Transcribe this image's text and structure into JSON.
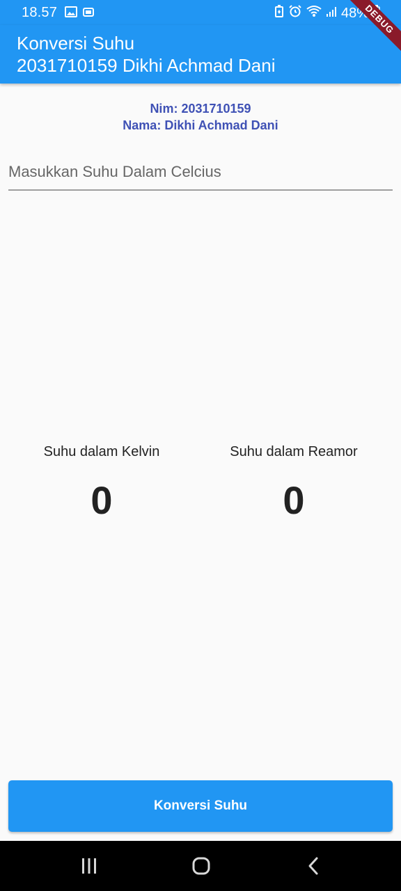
{
  "status_bar": {
    "time": "18.57",
    "battery": "48%",
    "left_icons": [
      "gallery-icon",
      "notification-app-icon"
    ],
    "right_icons": [
      "battery-saver-icon",
      "alarm-icon",
      "wifi-icon",
      "signal-icon",
      "battery-icon"
    ]
  },
  "app_bar": {
    "title_line1": "Konversi Suhu",
    "title_line2": "2031710159 Dikhi Achmad Dani",
    "debug_label": "DEBUG"
  },
  "identity": {
    "nim": "Nim: 2031710159",
    "nama": "Nama: Dikhi Achmad Dani"
  },
  "input": {
    "placeholder": "Masukkan Suhu Dalam Celcius",
    "value": ""
  },
  "results": {
    "kelvin_label": "Suhu dalam Kelvin",
    "kelvin_value": "0",
    "reamur_label": "Suhu dalam Reamor",
    "reamur_value": "0"
  },
  "button": {
    "label": "Konversi Suhu"
  },
  "nav": {
    "items": [
      "recent-apps-icon",
      "home-icon",
      "back-icon"
    ]
  },
  "colors": {
    "primary": "#2196f3",
    "identity_text": "#3f51b5",
    "background": "#fafafa",
    "nav_background": "#000000"
  }
}
